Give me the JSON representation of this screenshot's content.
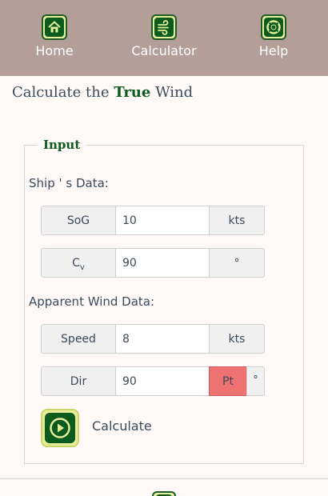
{
  "nav": {
    "items": [
      {
        "label": "Home",
        "icon": "home-icon"
      },
      {
        "label": "Calculator",
        "icon": "wind-icon"
      },
      {
        "label": "Help",
        "icon": "lifebuoy-icon"
      }
    ]
  },
  "title": {
    "prefix": "Calculate the ",
    "bold": "True",
    "suffix": " Wind"
  },
  "input": {
    "legend": "Input",
    "ship_section": "Ship ' s Data:",
    "ship": {
      "sog": {
        "label": "SoG",
        "value": "10",
        "unit": "kts"
      },
      "cv": {
        "label_main": "C",
        "label_sub": "v",
        "value": "90",
        "unit": "°"
      }
    },
    "wind_section": "Apparent Wind Data:",
    "wind": {
      "speed": {
        "label": "Speed",
        "value": "8",
        "unit": "kts"
      },
      "dir": {
        "label": "Dir",
        "value": "90",
        "side": "Pt",
        "unit": "°"
      }
    },
    "calculate": {
      "label": "Calculate",
      "icon": "play-icon"
    }
  },
  "colors": {
    "nav_bg": "#b39f98",
    "brand_green": "#0b5a1e",
    "icon_bg": "#e6ed9a",
    "port_red": "#ee7272"
  }
}
